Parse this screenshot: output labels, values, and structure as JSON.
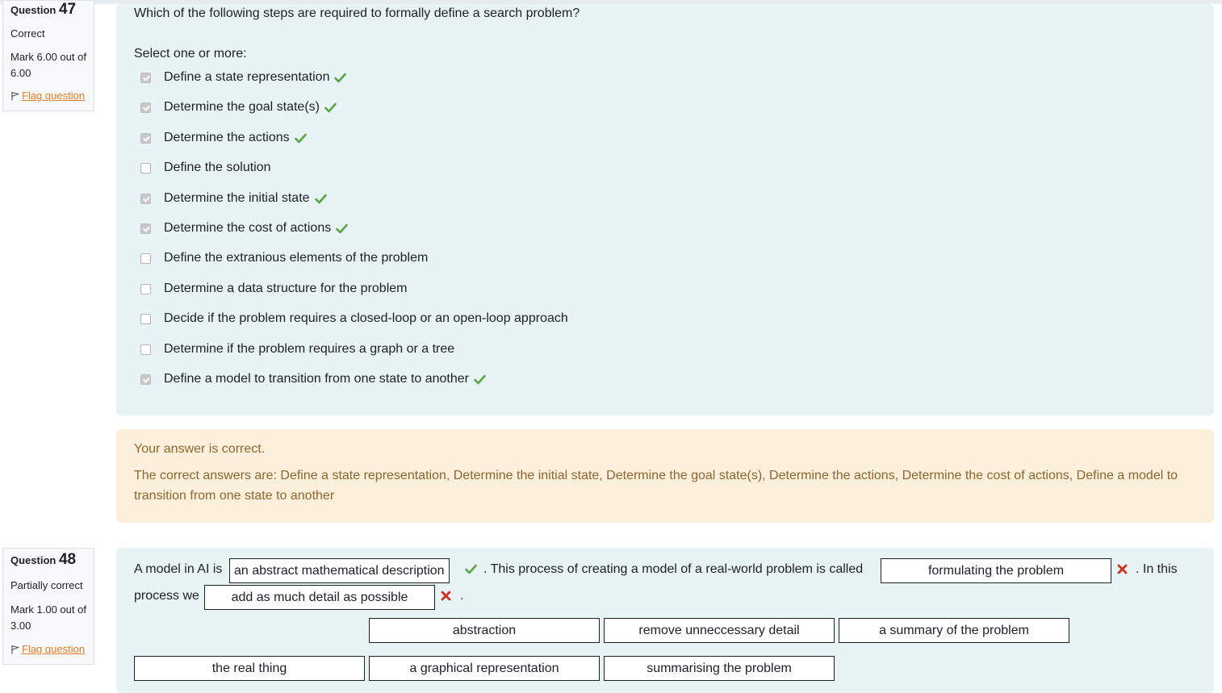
{
  "q47": {
    "info": {
      "label": "Question",
      "number": "47",
      "state": "Correct",
      "grade": "Mark 6.00 out of 6.00",
      "flag": "Flag question"
    },
    "text": "Which of the following steps are required to formally define a search problem?",
    "prompt": "Select one or more:",
    "options": [
      {
        "label": "Define a state representation",
        "checked": true,
        "correct": true
      },
      {
        "label": "Determine the goal state(s)",
        "checked": true,
        "correct": true
      },
      {
        "label": "Determine the actions",
        "checked": true,
        "correct": true
      },
      {
        "label": "Define the solution",
        "checked": false,
        "correct": false
      },
      {
        "label": "Determine the initial state",
        "checked": true,
        "correct": true
      },
      {
        "label": "Determine the cost of actions",
        "checked": true,
        "correct": true
      },
      {
        "label": "Define the extranious elements of the problem",
        "checked": false,
        "correct": false
      },
      {
        "label": "Determine a data structure for the problem",
        "checked": false,
        "correct": false
      },
      {
        "label": "Decide if the problem requires a closed-loop or an open-loop approach",
        "checked": false,
        "correct": false
      },
      {
        "label": "Determine if the problem requires a graph or a tree",
        "checked": false,
        "correct": false
      },
      {
        "label": "Define a model to transition from one state to another",
        "checked": true,
        "correct": true
      }
    ],
    "feedback": {
      "status": "Your answer is correct.",
      "answers": "The correct answers are: Define a state representation, Determine the initial state, Determine the goal state(s), Determine the actions, Determine the cost of actions, Define a model to transition from one state to another"
    }
  },
  "q48": {
    "info": {
      "label": "Question",
      "number": "48",
      "state": "Partially correct",
      "grade": "Mark 1.00 out of 3.00",
      "flag": "Flag question"
    },
    "text": {
      "part1": "A model in AI is",
      "part2": ". This process of creating a model of a real-world problem is called",
      "part3": ". In this",
      "part4": "process we",
      "part5": "."
    },
    "drops": [
      {
        "value": "an abstract mathematical description",
        "correct": true
      },
      {
        "value": "formulating the problem",
        "correct": false
      },
      {
        "value": "add as much detail as possible",
        "correct": false
      }
    ],
    "choices_row1": [
      "abstraction",
      "remove unneccessary detail",
      "a summary of the problem"
    ],
    "choices_row2": [
      "the real thing",
      "a graphical representation",
      "summarising the problem"
    ]
  },
  "colors": {
    "correct_tick": "#5aa440",
    "incorrect_cross": "#ca3120",
    "question_bg": "#e7f3f5",
    "feedback_bg": "#fcefdc",
    "feedback_text": "#8e662e",
    "flag_link": "#e87d23"
  },
  "icons": {
    "correct": "check-icon",
    "incorrect": "cross-icon",
    "flag": "flag-icon"
  }
}
